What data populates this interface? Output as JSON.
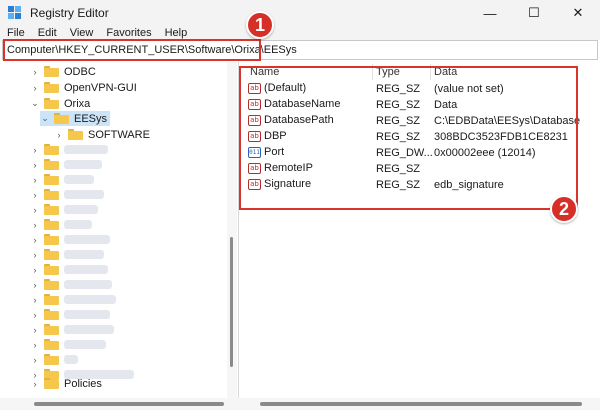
{
  "window": {
    "title": "Registry Editor",
    "controls": {
      "minimize": "—",
      "maximize": "☐",
      "close": "✕"
    }
  },
  "menu": [
    "File",
    "Edit",
    "View",
    "Favorites",
    "Help"
  ],
  "address": {
    "path": "Computer\\HKEY_CURRENT_USER\\Software\\Orixa\\EESys"
  },
  "tree": {
    "items": [
      {
        "label": "ODBC",
        "expanded": false,
        "selected": false
      },
      {
        "label": "OpenVPN-GUI",
        "expanded": false,
        "selected": false
      },
      {
        "label": "Orixa",
        "expanded": true,
        "selected": false
      },
      {
        "label": "EESys",
        "expanded": true,
        "selected": true
      },
      {
        "label": "SOFTWARE",
        "expanded": false,
        "selected": false
      },
      {
        "label": "Policies",
        "expanded": false,
        "selected": false
      }
    ]
  },
  "values": {
    "columns": {
      "name": "Name",
      "type": "Type",
      "data": "Data"
    },
    "rows": [
      {
        "name": "(Default)",
        "type": "REG_SZ",
        "data": "(value not set)",
        "icon": "string-value-icon"
      },
      {
        "name": "DatabaseName",
        "type": "REG_SZ",
        "data": "Data",
        "icon": "string-value-icon"
      },
      {
        "name": "DatabasePath",
        "type": "REG_SZ",
        "data": "C:\\EDBData\\EESys\\Database",
        "icon": "string-value-icon"
      },
      {
        "name": "DBP",
        "type": "REG_SZ",
        "data": "308BDC3523FDB1CE8231",
        "icon": "string-value-icon"
      },
      {
        "name": "Port",
        "type": "REG_DW...",
        "data": "0x00002eee (12014)",
        "icon": "binary-value-icon"
      },
      {
        "name": "RemoteIP",
        "type": "REG_SZ",
        "data": "",
        "icon": "string-value-icon"
      },
      {
        "name": "Signature",
        "type": "REG_SZ",
        "data": "edb_signature",
        "icon": "string-value-icon"
      }
    ]
  },
  "annotations": {
    "badge1": "1",
    "badge2": "2",
    "color": "#d9342b"
  }
}
